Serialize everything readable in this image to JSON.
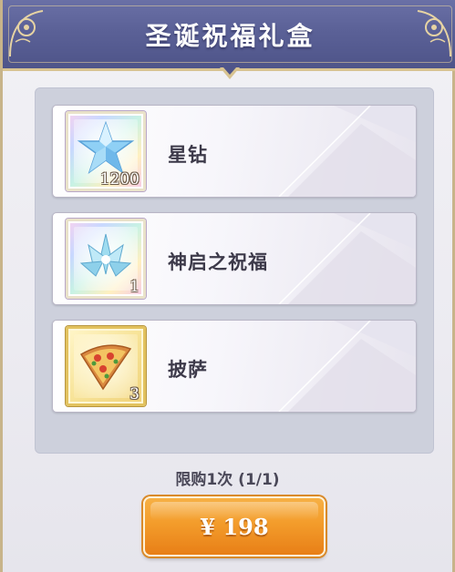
{
  "header": {
    "title": "圣诞祝福礼盒"
  },
  "items": [
    {
      "name": "星钻",
      "quantity": "1200",
      "icon": "star-diamond-icon",
      "frame": "rainbow"
    },
    {
      "name": "神启之祝福",
      "quantity": "1",
      "icon": "blessing-crystal-icon",
      "frame": "rainbow"
    },
    {
      "name": "披萨",
      "quantity": "3",
      "icon": "pizza-icon",
      "frame": "gold"
    }
  ],
  "purchase": {
    "limit_text": "限购1次 (1/1)",
    "price_label": "¥ 198"
  },
  "colors": {
    "header": "#5b6197",
    "accent_gold": "#d8c391",
    "button": "#f39c2b",
    "panel": "#cdd0dc"
  }
}
